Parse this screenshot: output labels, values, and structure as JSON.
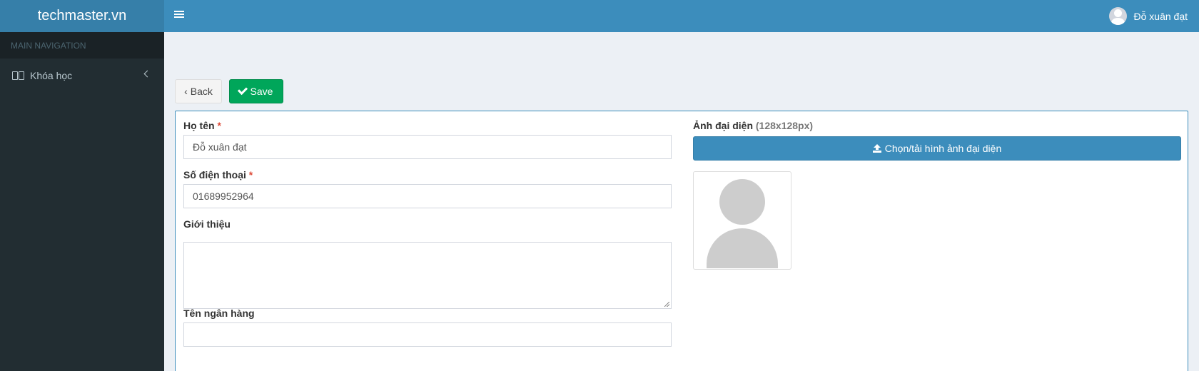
{
  "header": {
    "logo": "techmaster.vn",
    "user_name": "Đỗ xuân đạt"
  },
  "sidebar": {
    "section_title": "MAIN NAVIGATION",
    "items": [
      {
        "label": "Khóa học",
        "icon": "book-icon"
      }
    ]
  },
  "toolbar": {
    "back_label": "Back",
    "back_glyph": "‹",
    "save_label": "Save"
  },
  "form": {
    "name": {
      "label": "Họ tên",
      "required_mark": "*",
      "value": "Đỗ xuân đạt"
    },
    "phone": {
      "label": "Số điện thoại",
      "required_mark": "*",
      "value": "01689952964"
    },
    "intro": {
      "label": "Giới thiệu",
      "value": ""
    },
    "bank": {
      "label": "Tên ngân hàng",
      "value": ""
    },
    "avatar": {
      "label": "Ảnh đại diện",
      "hint": "(128x128px)",
      "upload_label": "Chọn/tải hình ảnh đại diện"
    }
  },
  "colors": {
    "header": "#3c8dbc",
    "logo_bg": "#367fa9",
    "sidebar": "#222d32",
    "save": "#00a65a",
    "required": "#dd4b39"
  }
}
